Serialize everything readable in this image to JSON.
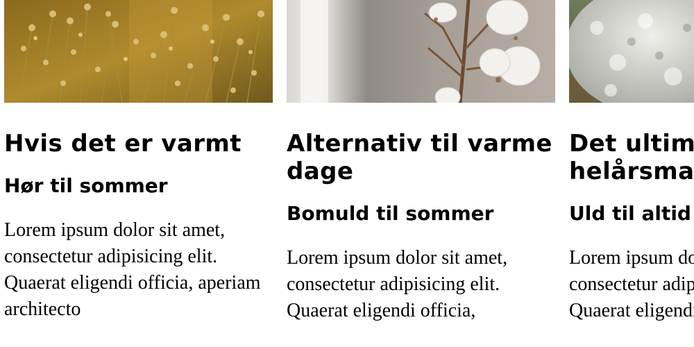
{
  "cards": [
    {
      "image_icon": "flax-flowers-photo",
      "title": "Hvis det er varmt",
      "subtitle": "Hør til sommer",
      "body": "Lorem ipsum dolor sit amet, consectetur adipisicing elit. Quaerat eligendi officia, aperiam architecto"
    },
    {
      "image_icon": "cotton-branch-photo",
      "title": "Alternativ til varme dage",
      "subtitle": "Bomuld til sommer",
      "body": "Lorem ipsum dolor sit amet, consectetur adipisicing elit. Quaerat eligendi officia,"
    },
    {
      "image_icon": "sheep-wool-photo",
      "title": "Det ultimative helårsmateriale",
      "subtitle": "Uld til altid",
      "body": "Lorem ipsum dolor sit amet, consectetur adipisicing elit. Quaerat eligendi officia,"
    }
  ]
}
